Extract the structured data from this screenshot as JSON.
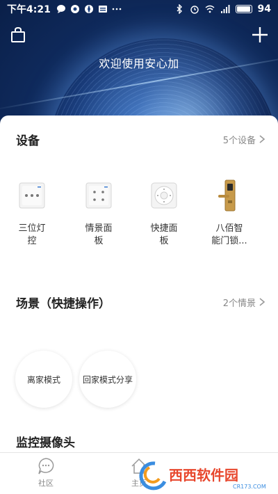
{
  "status_bar": {
    "time": "下午4:21",
    "battery": "94"
  },
  "header": {
    "welcome": "欢迎使用安心加"
  },
  "devices_section": {
    "title": "设备",
    "count": "5个设备",
    "items": [
      {
        "name_line1": "三位灯",
        "name_line2": "控"
      },
      {
        "name_line1": "情景面",
        "name_line2": "板"
      },
      {
        "name_line1": "快捷面",
        "name_line2": "板"
      },
      {
        "name_line1": "八佰智",
        "name_line2": "能门锁..."
      }
    ]
  },
  "scenes_section": {
    "title": "场景（快捷操作）",
    "count": "2个情景",
    "items": [
      {
        "label": "离家模式"
      },
      {
        "label": "回家模式分享"
      }
    ]
  },
  "camera_section": {
    "title": "监控摄像头"
  },
  "tabbar": {
    "tabs": [
      {
        "label": "社区",
        "icon": "chat-bubble-icon"
      },
      {
        "label": "主页",
        "icon": "home-icon"
      }
    ]
  },
  "watermark": {
    "text": "西西软件园",
    "sub": "CR173.COM"
  },
  "colors": {
    "accent": "#0f2a5c",
    "text": "#222222",
    "muted": "#888888"
  }
}
